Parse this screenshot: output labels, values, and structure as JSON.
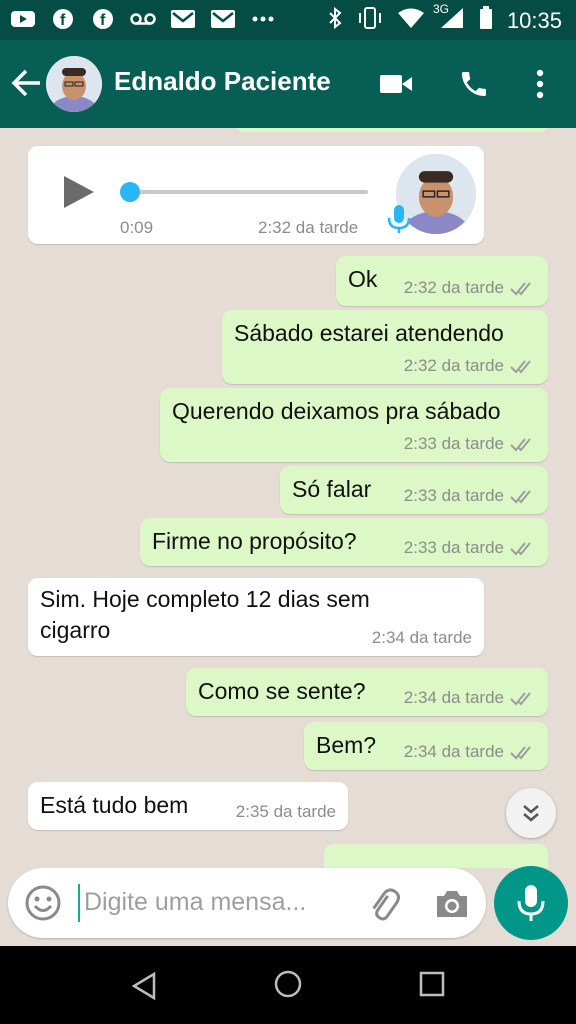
{
  "status_bar": {
    "time": "10:35",
    "network": "3G",
    "icons": [
      "youtube-icon",
      "facebook-icon",
      "facebook-icon",
      "voicemail-icon",
      "gmail-icon",
      "gmail-icon",
      "more-icon",
      "bluetooth-icon",
      "vibrate-icon",
      "wifi-icon",
      "signal-icon",
      "battery-icon"
    ]
  },
  "header": {
    "contact_name": "Ednaldo Paciente",
    "icons": [
      "back-arrow-icon",
      "avatar",
      "video-call-icon",
      "phone-call-icon",
      "more-vert-icon"
    ]
  },
  "voice_message": {
    "duration": "0:09",
    "time": "2:32 da tarde"
  },
  "messages": [
    {
      "direction": "out",
      "text": "Ok",
      "time": "2:32 da tarde"
    },
    {
      "direction": "out",
      "text": "Sábado estarei atendendo",
      "time": "2:32 da tarde"
    },
    {
      "direction": "out",
      "text": "Querendo deixamos pra sábado",
      "time": "2:33 da tarde"
    },
    {
      "direction": "out",
      "text": "Só falar",
      "time": "2:33 da tarde"
    },
    {
      "direction": "out",
      "text": "Firme no propósito?",
      "time": "2:33 da tarde"
    },
    {
      "direction": "in",
      "text": "Sim. Hoje completo 12 dias sem cigarro",
      "line1": "Sim. Hoje completo 12 dias sem",
      "line2": "cigarro",
      "time": "2:34 da tarde"
    },
    {
      "direction": "out",
      "text": "Como se sente?",
      "time": "2:34 da tarde"
    },
    {
      "direction": "out",
      "text": "Bem?",
      "time": "2:34 da tarde"
    },
    {
      "direction": "in",
      "text": "Está tudo bem",
      "time": "2:35 da tarde"
    }
  ],
  "composer": {
    "placeholder": "Digite uma mensa..."
  },
  "colors": {
    "appbar": "#075e54",
    "statusbar": "#054d44",
    "outgoing_bubble": "#dcf8c6",
    "incoming_bubble": "#ffffff",
    "chat_bg": "#e5ddd5",
    "accent": "#009688",
    "checks": "#9e9e9e"
  }
}
